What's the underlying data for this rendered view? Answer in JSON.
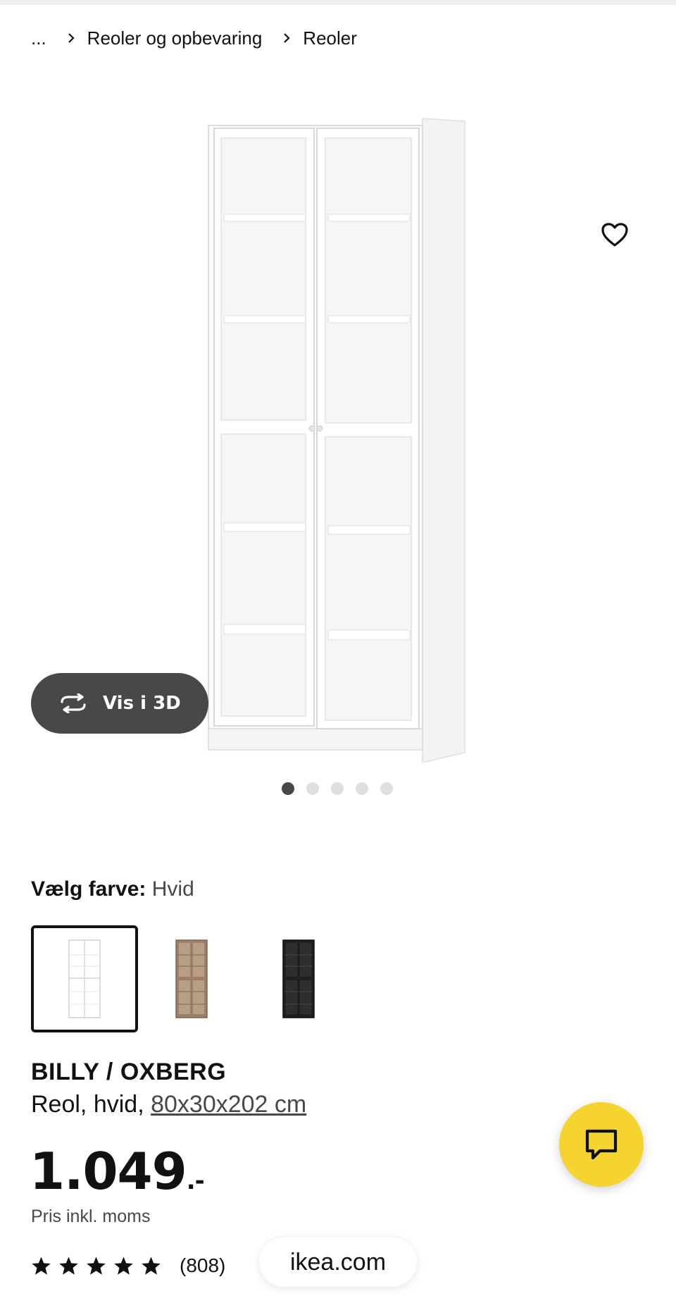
{
  "breadcrumb": {
    "ellipsis": "...",
    "items": [
      {
        "label": "Reoler og opbevaring"
      },
      {
        "label": "Reoler"
      }
    ]
  },
  "gallery": {
    "view_3d_label": "Vis i 3D",
    "dot_count": 5,
    "active_dot": 1
  },
  "color_select": {
    "heading_label": "Vælg farve:",
    "selected_value": "Hvid",
    "options": [
      {
        "name": "white",
        "color": "#ffffff"
      },
      {
        "name": "brown",
        "color": "#9b7f67"
      },
      {
        "name": "black",
        "color": "#1f1f1f"
      }
    ]
  },
  "product": {
    "name": "BILLY / OXBERG",
    "description": "Reol, hvid,",
    "dimensions": "80x30x202 cm",
    "price_main": "1.049",
    "price_suffix": ".-",
    "price_note": "Pris inkl. moms",
    "rating_stars": 5,
    "review_count": "(808)"
  },
  "browser": {
    "url": "ikea.com"
  },
  "colors": {
    "accent_yellow": "#f5d42f",
    "dark_grey": "#484848"
  },
  "icons": {
    "favorite": "heart-outline-icon",
    "view3d": "rotate-3d-icon",
    "chat": "chat-bubble-icon",
    "star": "star-icon"
  }
}
